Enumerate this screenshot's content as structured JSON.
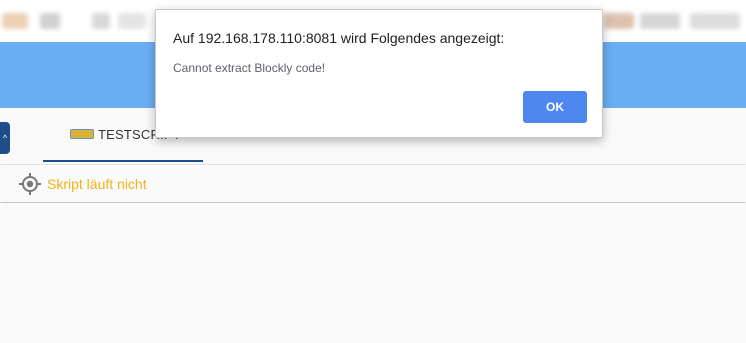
{
  "dialog": {
    "title": "Auf 192.168.178.110:8081 wird Folgendes angezeigt:",
    "message": "Cannot extract Blockly code!",
    "ok_label": "OK"
  },
  "tabs": [
    {
      "label": "TESTSCRIPT",
      "icon": "blockly-icon",
      "close": "×",
      "active": true
    }
  ],
  "sidebar_toggle": {
    "glyph": "^"
  },
  "status": {
    "icon": "crosshair-icon",
    "text": "Skript läuft nicht",
    "color": "#f0b318"
  },
  "colors": {
    "header": "#6aaef2",
    "tab_indicator": "#1e4d8c",
    "ok_button": "#4f87f0"
  }
}
